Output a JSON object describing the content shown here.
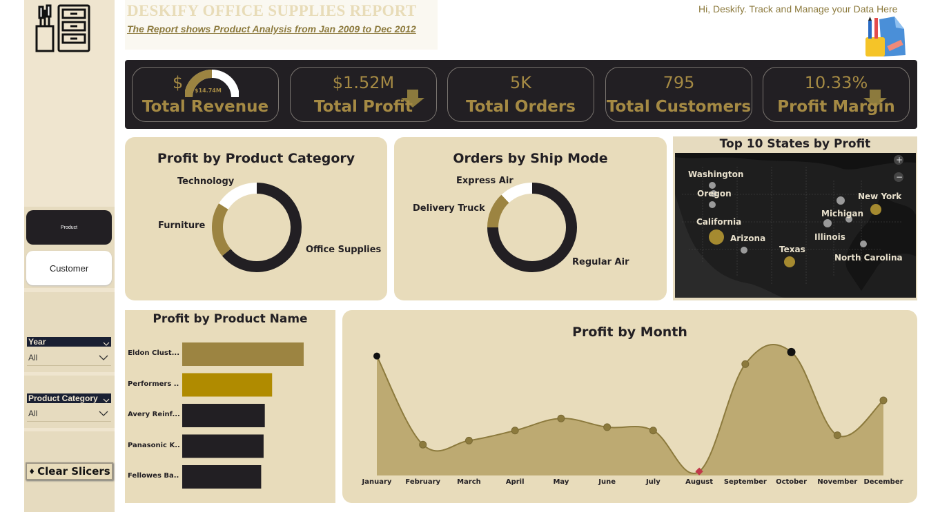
{
  "header": {
    "title": "DESKIFY OFFICE SUPPLIES REPORT",
    "subtitle": "The Report shows Product Analysis from Jan 2009 to Dec 2012",
    "greeting": "Hi, Deskify. Track and Manage your Data Here"
  },
  "sidebar": {
    "nav": [
      {
        "label": "Product",
        "active": true
      },
      {
        "label": "Customer",
        "active": false
      }
    ],
    "slicers": [
      {
        "label": "Year",
        "value": "All"
      },
      {
        "label": "Product Category",
        "value": "All"
      }
    ],
    "clear_label": "Clear Slicers"
  },
  "kpis": {
    "revenue": {
      "prefix": "$",
      "gauge_value": "$14.74M",
      "label": "Total Revenue"
    },
    "profit": {
      "value": "$1.52M",
      "label": "Total Profit"
    },
    "orders": {
      "value": "5K",
      "label": "Total Orders"
    },
    "customers": {
      "value": "795",
      "label": "Total Customers"
    },
    "margin": {
      "value": "10.33%",
      "label": "Profit Margin"
    }
  },
  "colors": {
    "dark": "#221f23",
    "gold": "#9c8441",
    "gold_bright": "#b08b00",
    "light": "#ffffff",
    "card": "#e8dcbb"
  },
  "map": {
    "title": "Top 10 States by Profit",
    "states": [
      "Washington",
      "Oregon",
      "California",
      "Arizona",
      "Texas",
      "Michigan",
      "Illinois",
      "New York",
      "North Carolina"
    ]
  },
  "chart_data": [
    {
      "type": "pie",
      "title": "Profit by Product Category",
      "categories": [
        "Office Supplies",
        "Furniture",
        "Technology"
      ],
      "values": [
        64,
        20,
        16
      ],
      "colors": [
        "#221f23",
        "#9c8441",
        "#ffffff"
      ]
    },
    {
      "type": "pie",
      "title": "Orders by Ship Mode",
      "categories": [
        "Regular Air",
        "Delivery Truck",
        "Express Air"
      ],
      "values": [
        75,
        13,
        12
      ],
      "colors": [
        "#221f23",
        "#9c8441",
        "#ffffff"
      ]
    },
    {
      "type": "bar",
      "title": "Profit by Product Name",
      "categories": [
        "Eldon Clust...",
        "Performers ...",
        "Avery Reinf...",
        "Panasonic K...",
        "Fellowes Ba..."
      ],
      "values": [
        100,
        74,
        68,
        67,
        65
      ],
      "colors": [
        "#9c8441",
        "#b08b00",
        "#221f23",
        "#221f23",
        "#221f23"
      ]
    },
    {
      "type": "area",
      "title": "Profit by Month",
      "categories": [
        "January",
        "February",
        "March",
        "April",
        "May",
        "June",
        "July",
        "August",
        "September",
        "October",
        "November",
        "December"
      ],
      "values": [
        178,
        46,
        52,
        67,
        85,
        72,
        67,
        6,
        166,
        184,
        60,
        112
      ],
      "highlight_max": "October",
      "highlight_min": "August"
    }
  ]
}
